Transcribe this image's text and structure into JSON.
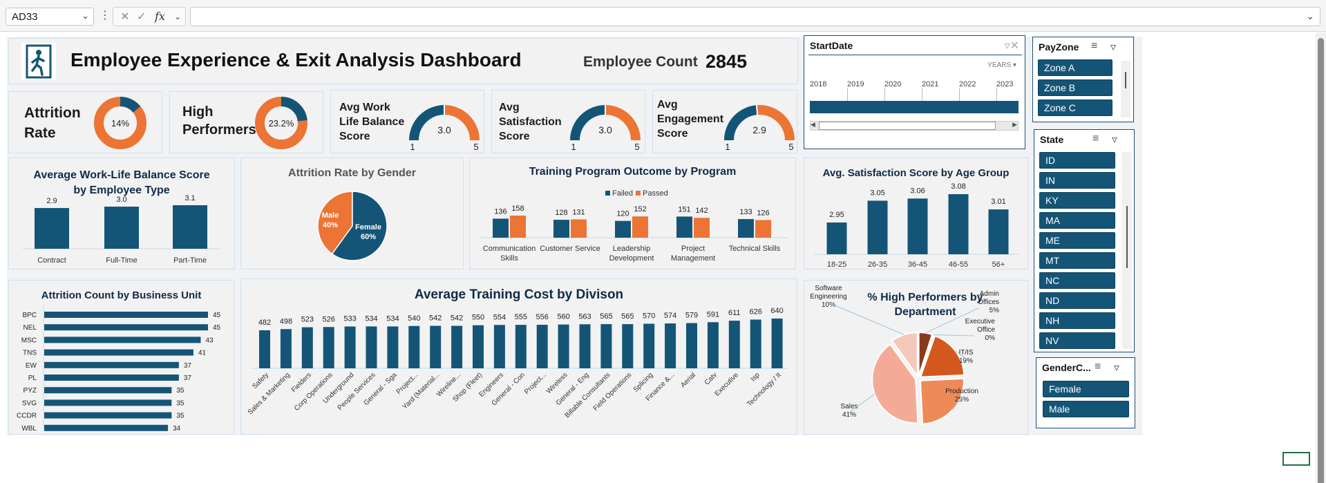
{
  "formula_bar": {
    "name_box": "AD33",
    "formula": ""
  },
  "dashboard": {
    "title": "Employee Experience & Exit Analysis Dashboard",
    "employee_count_label": "Employee Count",
    "employee_count": "2845"
  },
  "kpis": {
    "attrition": {
      "label_line1": "Attrition",
      "label_line2": "Rate",
      "value": "14%",
      "pct": 14
    },
    "high_performers": {
      "label_line1": "High",
      "label_line2": "Performers",
      "value": "23.2%",
      "pct": 23.2
    },
    "work_life": {
      "label_lines": [
        "Avg Work",
        "Life Balance",
        "Score"
      ],
      "value": "3.0",
      "min": "1",
      "max": "5",
      "score": 3.0
    },
    "satisfaction": {
      "label_lines": [
        "Avg",
        "Satisfaction",
        "Score"
      ],
      "value": "3.0",
      "min": "1",
      "max": "5",
      "score": 3.0
    },
    "engagement": {
      "label_lines": [
        "Avg",
        "Engagement",
        "Score"
      ],
      "value": "2.9",
      "min": "1",
      "max": "5",
      "score": 2.9
    }
  },
  "colors": {
    "navy": "#145577",
    "orange": "#ec7434",
    "dark_text": "#0e2a47"
  },
  "chart_data": [
    {
      "id": "wlb",
      "type": "bar",
      "title_lines": [
        "Average Work-Life Balance Score",
        "by Employee Type"
      ],
      "categories": [
        "Contract",
        "Full-Time",
        "Part-Time"
      ],
      "values": [
        2.9,
        3.0,
        3.1
      ],
      "labels": [
        "2.9",
        "3.0",
        "3.1"
      ]
    },
    {
      "id": "gender",
      "type": "pie",
      "title": "Attrition Rate by Gender",
      "slices": [
        {
          "name": "Male",
          "label": "40%",
          "value": 40,
          "color": "#ec7434"
        },
        {
          "name": "Female",
          "label": "60%",
          "value": 60,
          "color": "#145577"
        }
      ]
    },
    {
      "id": "training",
      "type": "bar",
      "title": "Training Program Outcome by Program",
      "legend": [
        "Failed",
        "Passed"
      ],
      "categories": [
        [
          "Communication",
          "Skills"
        ],
        [
          "Customer Service"
        ],
        [
          "Leadership",
          "Development"
        ],
        [
          "Project",
          "Management"
        ],
        [
          "Technical Skills"
        ]
      ],
      "series": [
        {
          "name": "Failed",
          "values": [
            136,
            128,
            120,
            151,
            133
          ],
          "color": "#145577"
        },
        {
          "name": "Passed",
          "values": [
            158,
            131,
            152,
            142,
            126
          ],
          "color": "#ec7434"
        }
      ]
    },
    {
      "id": "agegroup",
      "type": "bar",
      "title": "Avg. Satisfaction Score by Age Group",
      "categories": [
        "18-25",
        "26-35",
        "36-45",
        "46-55",
        "56+"
      ],
      "values": [
        2.95,
        3.05,
        3.06,
        3.08,
        3.01
      ],
      "labels": [
        "2.95",
        "3.05",
        "3.06",
        "3.08",
        "3.01"
      ]
    },
    {
      "id": "bu",
      "type": "bar",
      "orientation": "horizontal",
      "title": "Attrition Count by Business Unit",
      "categories": [
        "BPC",
        "NEL",
        "MSC",
        "TNS",
        "EW",
        "PL",
        "PYZ",
        "SVG",
        "CCDR",
        "WBL"
      ],
      "values": [
        45,
        45,
        43,
        41,
        37,
        37,
        35,
        35,
        35,
        34
      ]
    },
    {
      "id": "division",
      "type": "bar",
      "title": "Average Training Cost by Divison",
      "categories": [
        "Safety",
        "Sales & Marketing",
        "Fielders",
        "Corp Operations",
        "Underground",
        "People Services",
        "General - Sga",
        "Project...",
        "Yard (Material...",
        "Wireline...",
        "Shop (Fleet)",
        "Engineers",
        "General - Con",
        "Project...",
        "Wireless",
        "General - Eng",
        "Billable Consultants",
        "Field Operations",
        "Splicing",
        "Finance &...",
        "Aerial",
        "Catv",
        "Executive",
        "Isp",
        "Technology / It"
      ],
      "values": [
        482,
        498,
        523,
        526,
        533,
        534,
        534,
        540,
        542,
        542,
        550,
        554,
        555,
        556,
        560,
        563,
        565,
        565,
        570,
        574,
        579,
        591,
        611,
        626,
        640
      ]
    },
    {
      "id": "dept",
      "type": "pie",
      "title_lines": [
        "% High Performers by",
        "Department"
      ],
      "slices": [
        {
          "name": "Admin Offices",
          "label": "5%",
          "value": 5,
          "color": "#8a3a1c"
        },
        {
          "name": "Executive Office",
          "label": "0%",
          "value": 0.4,
          "color": "#6b2a14"
        },
        {
          "name": "IT/IS",
          "label": "19%",
          "value": 19,
          "color": "#d4581e"
        },
        {
          "name": "Production",
          "label": "25%",
          "value": 25,
          "color": "#ee8a58"
        },
        {
          "name": "Sales",
          "label": "41%",
          "value": 41,
          "color": "#f3ab98"
        },
        {
          "name": "Software Engineering",
          "label": "10%",
          "value": 10,
          "color": "#f5c8bc"
        }
      ]
    }
  ],
  "slicers": {
    "startdate": {
      "title": "StartDate",
      "unit": "YEARS",
      "years": [
        "2018",
        "2019",
        "2020",
        "2021",
        "2022",
        "2023"
      ]
    },
    "payzone": {
      "title": "PayZone",
      "items": [
        "Zone A",
        "Zone B",
        "Zone C"
      ]
    },
    "state": {
      "title": "State",
      "items": [
        "ID",
        "IN",
        "KY",
        "MA",
        "ME",
        "MT",
        "NC",
        "ND",
        "NH",
        "NV"
      ]
    },
    "gender": {
      "title": "GenderC...",
      "items": [
        "Female",
        "Male"
      ]
    }
  }
}
